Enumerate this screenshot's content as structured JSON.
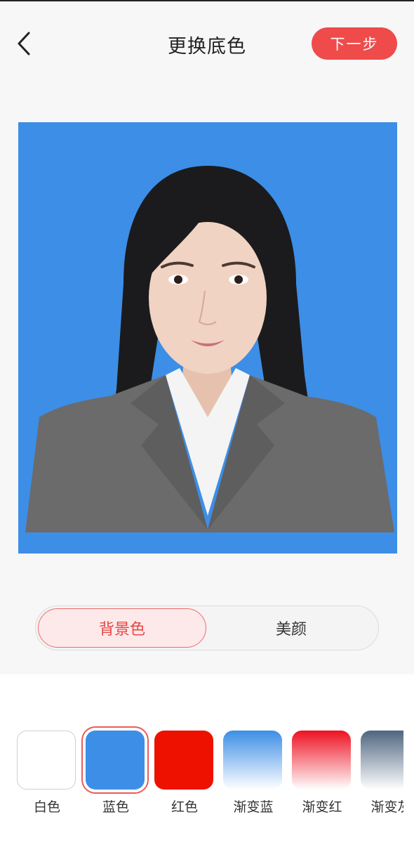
{
  "header": {
    "title": "更换底色",
    "next_label": "下一步"
  },
  "colors": {
    "accent": "#ef4b4b",
    "photo_background": "#3d8ee6"
  },
  "tabs": [
    {
      "label": "背景色",
      "active": true
    },
    {
      "label": "美颜",
      "active": false
    }
  ],
  "swatches": [
    {
      "label": "白色",
      "selected": false
    },
    {
      "label": "蓝色",
      "selected": true
    },
    {
      "label": "红色",
      "selected": false
    },
    {
      "label": "渐变蓝",
      "selected": false
    },
    {
      "label": "渐变红",
      "selected": false
    },
    {
      "label": "渐变灰",
      "selected": false
    }
  ]
}
